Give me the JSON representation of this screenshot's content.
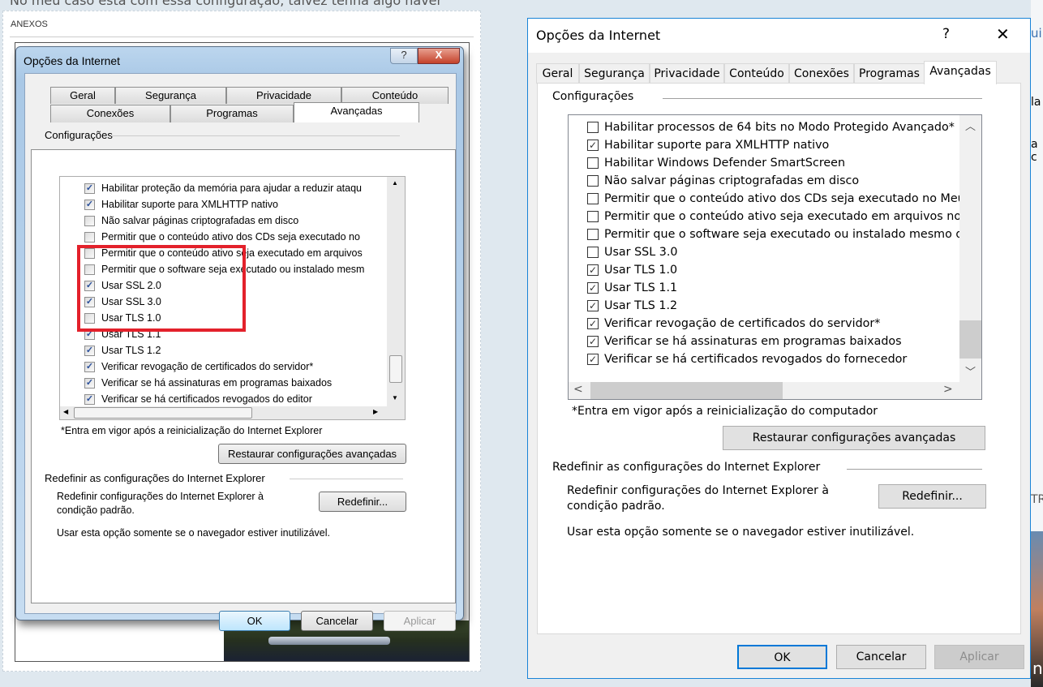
{
  "page": {
    "top_text": "No meu caso está com essa configuração, talvez tenha algo haver",
    "attachments_label": "ANEXOS",
    "right_edge_fragments": [
      "ui",
      "la",
      "a c",
      "TR",
      "n"
    ]
  },
  "old_dialog": {
    "title": "Opções da Internet",
    "help": "?",
    "close": "X",
    "tabs_row1": [
      "Geral",
      "Segurança",
      "Privacidade",
      "Conteúdo"
    ],
    "tabs_row2": [
      "Conexões",
      "Programas",
      "Avançadas"
    ],
    "selected_tab": "Avançadas",
    "settings_label": "Configurações",
    "items": [
      {
        "label": "Habilitar proteção da memória para ajudar a reduzir ataqu",
        "checked": true
      },
      {
        "label": "Habilitar suporte para XMLHTTP nativo",
        "checked": true
      },
      {
        "label": "Não salvar páginas criptografadas em disco",
        "checked": false
      },
      {
        "label": "Permitir que o conteúdo ativo dos CDs seja executado no",
        "checked": false
      },
      {
        "label": "Permitir que o conteúdo ativo seja executado em arquivos",
        "checked": false
      },
      {
        "label": "Permitir que o software seja executado ou instalado mesm",
        "checked": false
      },
      {
        "label": "Usar SSL 2.0",
        "checked": true
      },
      {
        "label": "Usar SSL 3.0",
        "checked": true
      },
      {
        "label": "Usar TLS 1.0",
        "checked": false
      },
      {
        "label": "Usar TLS 1.1",
        "checked": true
      },
      {
        "label": "Usar TLS 1.2",
        "checked": true
      },
      {
        "label": "Verificar revogação de certificados do servidor*",
        "checked": true
      },
      {
        "label": "Verificar se há assinaturas em programas baixados",
        "checked": true
      },
      {
        "label": "Verificar se há certificados revogados do editor",
        "checked": true
      }
    ],
    "footnote": "*Entra em vigor após a reinicialização do Internet Explorer",
    "restore_button": "Restaurar configurações avançadas",
    "reset_heading": "Redefinir as configurações do Internet Explorer",
    "reset_text_1": "Redefinir configurações do Internet Explorer à",
    "reset_text_2": "condição padrão.",
    "reset_button": "Redefinir...",
    "reset_note": "Usar esta opção somente se o navegador estiver inutilizável.",
    "ok": "OK",
    "cancel": "Cancelar",
    "apply": "Aplicar",
    "highlight_color": "#e3212b"
  },
  "new_dialog": {
    "title": "Opções da Internet",
    "help": "?",
    "close": "✕",
    "tabs": [
      "Geral",
      "Segurança",
      "Privacidade",
      "Conteúdo",
      "Conexões",
      "Programas",
      "Avançadas"
    ],
    "selected_tab": "Avançadas",
    "settings_label": "Configurações",
    "items": [
      {
        "label": "Habilitar processos de 64 bits no Modo Protegido Avançado*",
        "checked": false
      },
      {
        "label": "Habilitar suporte para XMLHTTP nativo",
        "checked": true
      },
      {
        "label": "Habilitar Windows Defender SmartScreen",
        "checked": false
      },
      {
        "label": "Não salvar páginas criptografadas em disco",
        "checked": false
      },
      {
        "label": "Permitir que o conteúdo ativo dos CDs seja executado no Meu",
        "checked": false
      },
      {
        "label": "Permitir que o conteúdo ativo seja executado em arquivos no",
        "checked": false
      },
      {
        "label": "Permitir que o software seja executado ou instalado mesmo q",
        "checked": false
      },
      {
        "label": "Usar SSL 3.0",
        "checked": false
      },
      {
        "label": "Usar TLS 1.0",
        "checked": true
      },
      {
        "label": "Usar TLS 1.1",
        "checked": true
      },
      {
        "label": "Usar TLS 1.2",
        "checked": true
      },
      {
        "label": "Verificar revogação de certificados do servidor*",
        "checked": true
      },
      {
        "label": "Verificar se há assinaturas em programas baixados",
        "checked": true
      },
      {
        "label": "Verificar se há certificados revogados do fornecedor",
        "checked": true
      }
    ],
    "footnote": "*Entra em vigor após a reinicialização do computador",
    "restore_button": "Restaurar configurações avançadas",
    "reset_heading": "Redefinir as configurações do Internet Explorer",
    "reset_text_1": "Redefinir configurações do Internet Explorer à",
    "reset_text_2": "condição padrão.",
    "reset_button": "Redefinir...",
    "reset_note": "Usar esta opção somente se o navegador estiver inutilizável.",
    "ok": "OK",
    "cancel": "Cancelar",
    "apply": "Aplicar",
    "accent": "#1883d7"
  }
}
